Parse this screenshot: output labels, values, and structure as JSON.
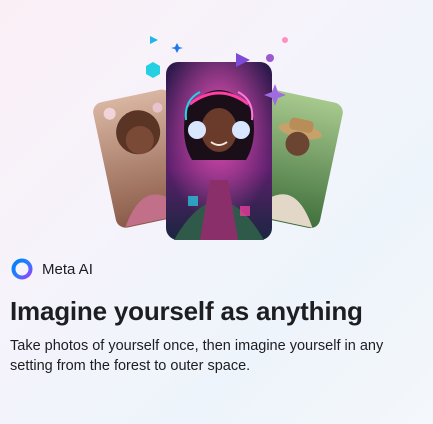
{
  "brand": {
    "name": "Meta AI",
    "logo_icon": "meta-ai-ring-icon"
  },
  "headline": "Imagine yourself as anything",
  "description": "Take photos of yourself once, then imagine yourself in any setting from the forest to outer space.",
  "hero": {
    "cards": [
      {
        "icon": "portrait-floral-photo",
        "accent": "#c9a18a"
      },
      {
        "icon": "portrait-headphones-neon-photo",
        "accent": "#8a3ec8"
      },
      {
        "icon": "portrait-hat-garden-photo",
        "accent": "#7fb06a"
      }
    ],
    "sparkles": [
      "sparkle-icon",
      "sparkle-icon",
      "triangle-icon",
      "dot-icon"
    ]
  },
  "colors": {
    "logo_gradient_start": "#0082fb",
    "logo_gradient_end": "#a33bff",
    "neon_pink": "#ff3fa4",
    "neon_cyan": "#21d4e8",
    "text_primary": "#1c1e21"
  }
}
